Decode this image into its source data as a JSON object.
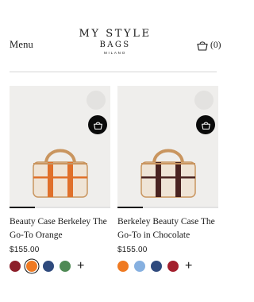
{
  "header": {
    "menu_label": "Menu",
    "logo": {
      "line1": "MY STYLE",
      "line2": "BAGS",
      "line3": "MILANO"
    },
    "cart_count": "(0)",
    "cart_icon": "shopping-basket-icon"
  },
  "products": [
    {
      "title": "Beauty Case Berkeley The Go-To Orange",
      "price": "$155.00",
      "image_progress_fraction": 0.25,
      "stripe_color": "#e0702a",
      "swatches": [
        "#8c1f2a",
        "#ef7a22",
        "#2f4a7d",
        "#4f8a55"
      ],
      "selected_swatch": 1,
      "more_swatches": "+"
    },
    {
      "title": "Berkeley Beauty Case The Go-To in Chocolate",
      "price": "$155.00",
      "image_progress_fraction": 0.25,
      "stripe_color": "#4a2320",
      "swatches": [
        "#ef7a22",
        "#86b0e0",
        "#2f4a7d",
        "#a31f2d"
      ],
      "selected_swatch": null,
      "more_swatches": "+"
    }
  ],
  "colors": {
    "bag_canvas": "#efe4d6",
    "leather": "#c9955f",
    "photo_bg": "#efeeec"
  }
}
